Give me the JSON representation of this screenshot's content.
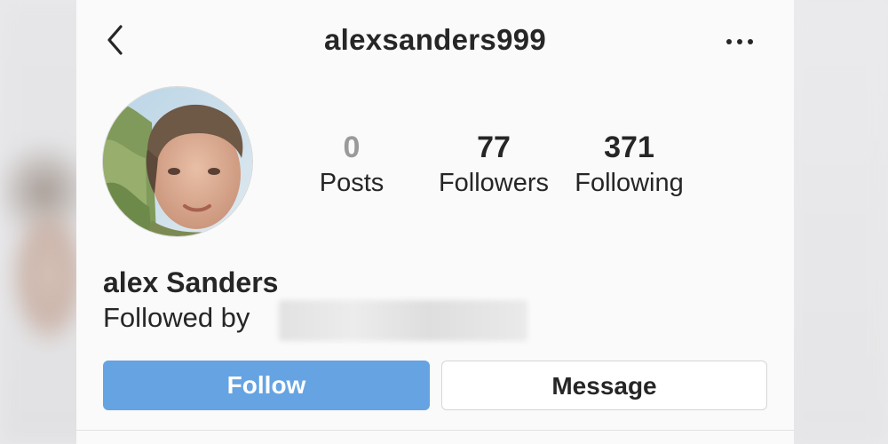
{
  "header": {
    "username": "alexsanders999",
    "back_icon": "chevron-left-icon",
    "more_icon": "more-horizontal-icon"
  },
  "profile": {
    "avatar": "profile-photo",
    "full_name": "alex Sanders",
    "followed_by_label": "Followed by"
  },
  "stats": [
    {
      "value": "0",
      "label": "Posts"
    },
    {
      "value": "77",
      "label": "Followers"
    },
    {
      "value": "371",
      "label": "Following"
    }
  ],
  "actions": {
    "follow_label": "Follow",
    "message_label": "Message"
  },
  "colors": {
    "follow_button": "#66a3e2",
    "text": "#262626",
    "background": "#fafafa"
  }
}
